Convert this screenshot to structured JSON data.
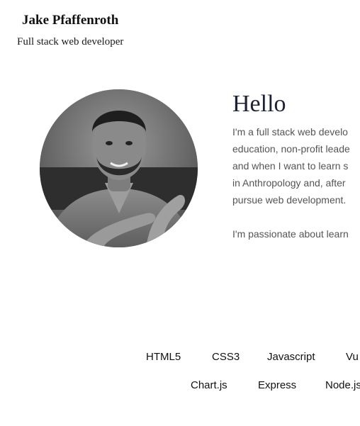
{
  "header": {
    "name": "Jake Pfaffenroth",
    "tagline": "Full stack web developer"
  },
  "portrait": {
    "icon": "portrait-photo",
    "tone": "#6b6b6b"
  },
  "intro": {
    "heading": "Hello",
    "lines": [
      "I'm a full stack web develo",
      "education, non-profit leade",
      "and when I want to learn s",
      "in Anthropology and, after",
      "pursue web development."
    ],
    "passion": "I'm passionate about learn"
  },
  "skills": {
    "row1": [
      "HTML5",
      "CSS3",
      "Javascript",
      "Vu"
    ],
    "row2": [
      "Chart.js",
      "Express",
      "Node.js"
    ]
  },
  "colors": {
    "heading": "#1c2233",
    "body_text": "#555555",
    "background": "#ffffff"
  }
}
